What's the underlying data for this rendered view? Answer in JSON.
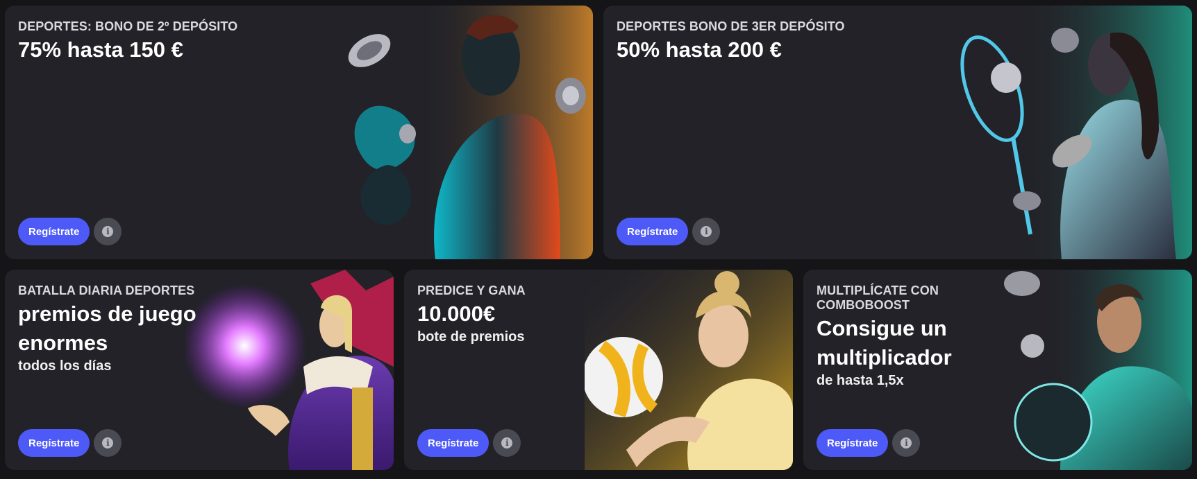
{
  "cards": [
    {
      "eyebrow": "DEPORTES: BONO DE 2º DEPÓSITO",
      "headline": "75% hasta 150 €",
      "subline": "",
      "cta": "Regístrate",
      "art": "boxer-illustration",
      "accent": "#d98b2b"
    },
    {
      "eyebrow": "DEPORTES BONO DE 3ER DEPÓSITO",
      "headline": "50% hasta 200 €",
      "subline": "",
      "cta": "Regístrate",
      "art": "tennis-player-illustration",
      "accent": "#1fa88f"
    },
    {
      "eyebrow": "BATALLA DIARIA DEPORTES",
      "headline": "premios de juego enormes",
      "subline": "todos los días",
      "cta": "Regístrate",
      "art": "wizard-illustration",
      "accent": "#b03ad9"
    },
    {
      "eyebrow": "PREDICE Y GANA",
      "headline": "10.000€",
      "subline": "bote de premios",
      "cta": "Regístrate",
      "art": "volleyball-player-illustration",
      "accent": "#e9b21c"
    },
    {
      "eyebrow": "MULTIPLÍCATE CON COMBOBOOST",
      "headline": "Consigue un multiplicador",
      "subline": "de hasta 1,5x",
      "cta": "Regístrate",
      "art": "footballer-illustration",
      "accent": "#1fb39a"
    }
  ],
  "icons": {
    "info": "info-icon"
  }
}
